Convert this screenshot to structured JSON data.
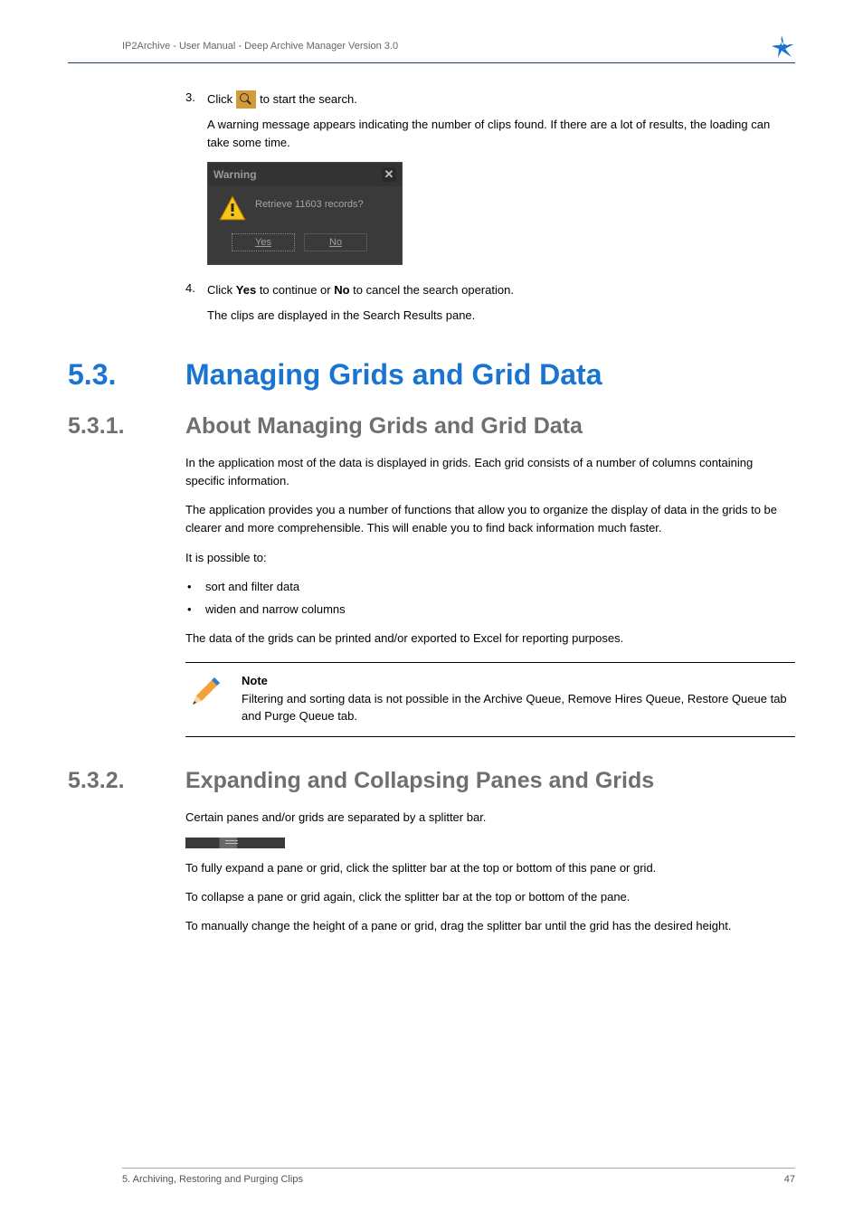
{
  "header": {
    "breadcrumb": "IP2Archive - User Manual - Deep Archive Manager Version 3.0"
  },
  "step3": {
    "number": "3.",
    "pre": "Click",
    "post": "to start the search.",
    "sub": "A warning message appears indicating the number of clips found. If there are a lot of results, the loading can take some time."
  },
  "dialog": {
    "title": "Warning",
    "message": "Retrieve 11603 records?",
    "yes": "Yes",
    "no": "No"
  },
  "step4": {
    "number": "4.",
    "pre": "Click ",
    "yes": "Yes",
    "mid": " to continue or ",
    "no": "No",
    "post": " to cancel the search operation.",
    "sub": "The clips are displayed in the Search Results pane."
  },
  "sec53": {
    "num": "5.3.",
    "title": "Managing Grids and Grid Data"
  },
  "sec531": {
    "num": "5.3.1.",
    "title": "About Managing Grids and Grid Data",
    "p1": "In the application most of the data is displayed in grids. Each grid consists of a number of columns containing specific information.",
    "p2": "The application provides you a number of functions that allow you to organize the display of data in the grids to be clearer and more comprehensible. This will enable you to find back information much faster.",
    "p3": "It is possible to:",
    "b1": "sort and filter data",
    "b2": "widen and narrow columns",
    "p4": "The data of the grids can be printed and/or exported to Excel for reporting purposes."
  },
  "note": {
    "heading": "Note",
    "body": "Filtering and sorting data is not possible in the Archive Queue, Remove Hires Queue, Restore Queue tab and Purge Queue tab."
  },
  "sec532": {
    "num": "5.3.2.",
    "title": "Expanding and Collapsing Panes and Grids",
    "p1": "Certain panes and/or grids are separated by a splitter bar.",
    "p2": "To fully expand a pane or grid, click the splitter bar at the top or bottom of this pane or grid.",
    "p3": "To collapse a pane or grid again, click the splitter bar at the top or bottom of the pane.",
    "p4": "To manually change the height of a pane or grid, drag the splitter bar until the grid has the desired height."
  },
  "footer": {
    "left": "5. Archiving, Restoring and Purging Clips",
    "right": "47"
  }
}
